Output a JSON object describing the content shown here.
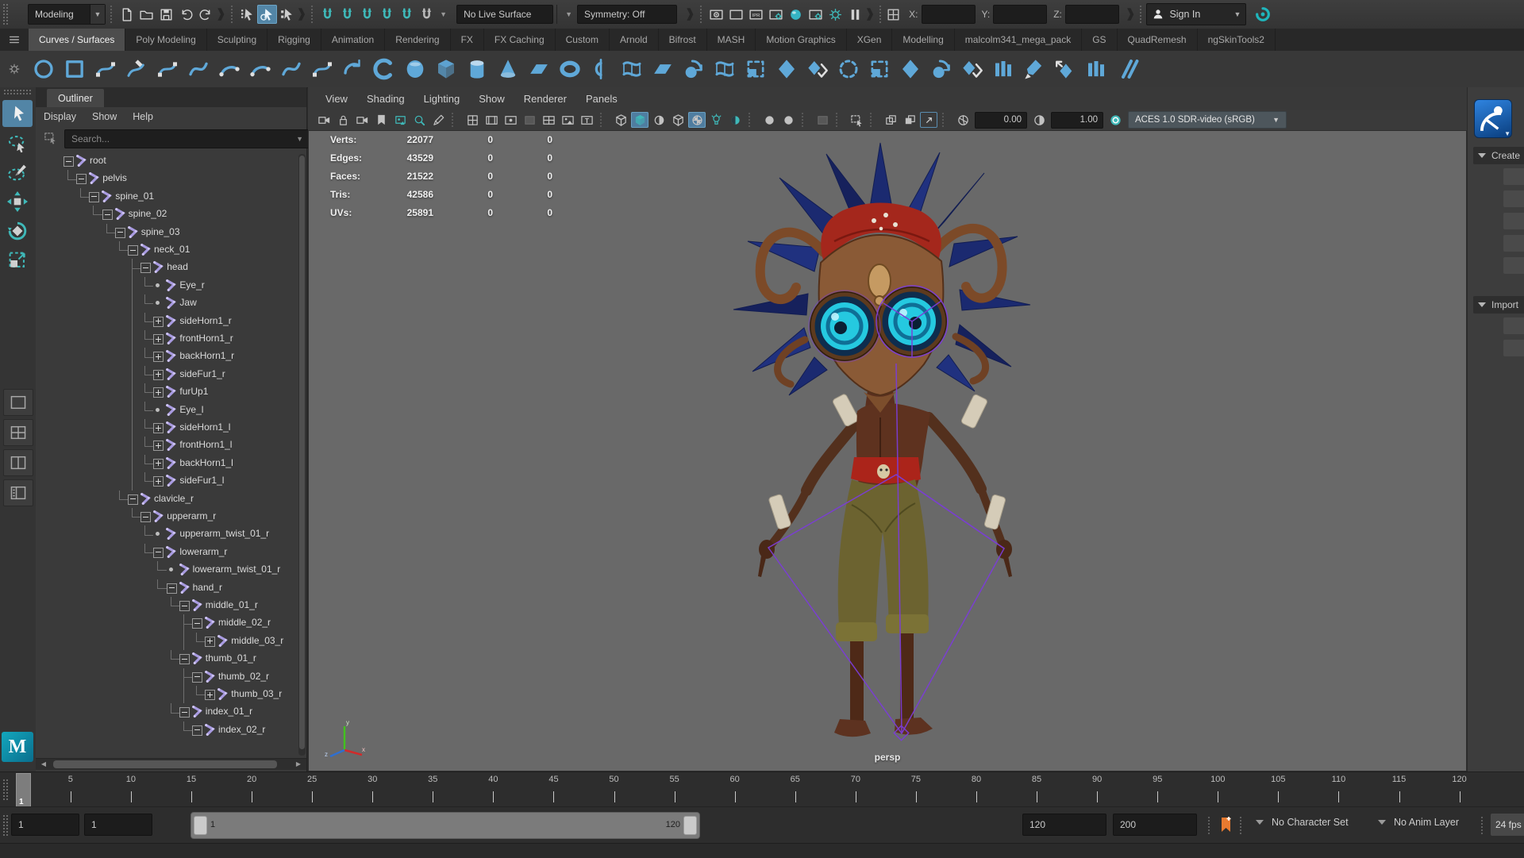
{
  "colors": {
    "accent_teal": "#3fb9b9",
    "highlight_blue": "#5285a6",
    "shelf_icon_blue": "#5fa8d8",
    "joint_purple": "#a89ae0",
    "rig_purple": "#7b3dd6",
    "viewport_bg": "#696969",
    "bookmark_orange": "#e87a30"
  },
  "top_toolbar": {
    "menu_set": "Modeling",
    "file_icons": [
      "new-scene-icon",
      "open-scene-icon",
      "save-scene-icon",
      "undo-icon",
      "redo-icon"
    ],
    "selection_icons": [
      "select-hierarchy-icon",
      "select-object-icon",
      "select-component-icon"
    ],
    "active_selection": "select-object-icon",
    "snap_icons": [
      "snap-grid-icon",
      "snap-curve-icon",
      "snap-point-icon",
      "snap-projected-center-icon",
      "snap-view-plane-icon",
      "make-live-icon"
    ],
    "live_surface": "No Live Surface",
    "symmetry": "Symmetry: Off",
    "render_icons": [
      "render-view-icon",
      "render-current-frame-icon",
      "ipr-render-icon",
      "render-settings-icon",
      "hypershade-icon",
      "light-editor-icon",
      "interactive-shading-icon",
      "pause-viewport-icon"
    ],
    "coords": {
      "x_label": "X:",
      "y_label": "Y:",
      "z_label": "Z:",
      "x_value": "",
      "y_value": "",
      "z_value": ""
    },
    "sign_in": "Sign In"
  },
  "shelf": {
    "tabs": [
      "Curves / Surfaces",
      "Poly Modeling",
      "Sculpting",
      "Rigging",
      "Animation",
      "Rendering",
      "FX",
      "FX Caching",
      "Custom",
      "Arnold",
      "Bifrost",
      "MASH",
      "Motion Graphics",
      "XGen",
      "Modelling",
      "malcolm341_mega_pack",
      "GS",
      "QuadRemesh",
      "ngSkinTools2"
    ],
    "active_tab": "Curves / Surfaces",
    "icons": [
      "nurbs-circle",
      "nurbs-square",
      "cv-curve-tool",
      "pencil-curve-tool",
      "ep-curve-tool",
      "bezier-curve-tool",
      "three-point-arc",
      "two-point-arc",
      "curve-fillet",
      "insert-knot",
      "extend-curve",
      "offset-curve",
      "nurbs-sphere",
      "nurbs-cube",
      "nurbs-cylinder",
      "nurbs-cone",
      "nurbs-plane",
      "nurbs-torus",
      "revolve",
      "loft",
      "planar",
      "extrude",
      "birail",
      "boundary",
      "bevel",
      "bevel-plus",
      "trim-tool",
      "untrim",
      "intersect-surfaces",
      "project-curve",
      "surface-fillet",
      "stitch",
      "sculpt-surfaces-tool",
      "smooth-curve",
      "rebuild-surface",
      "booleans"
    ]
  },
  "toolbox": {
    "tools": [
      "select-tool",
      "lasso-select-tool",
      "paint-select-tool",
      "move-tool",
      "rotate-tool",
      "scale-tool"
    ],
    "active_tool": "select-tool",
    "layouts": [
      "single-pane-layout",
      "four-pane-layout",
      "two-pane-layout",
      "outliner-persp-layout"
    ]
  },
  "outliner": {
    "title": "Outliner",
    "menus": [
      "Display",
      "Show",
      "Help"
    ],
    "search_placeholder": "Search...",
    "tree": [
      {
        "label": "root",
        "depth": 0,
        "exp": "minus"
      },
      {
        "label": "pelvis",
        "depth": 1,
        "exp": "minus"
      },
      {
        "label": "spine_01",
        "depth": 2,
        "exp": "minus"
      },
      {
        "label": "spine_02",
        "depth": 3,
        "exp": "minus"
      },
      {
        "label": "spine_03",
        "depth": 4,
        "exp": "minus"
      },
      {
        "label": "neck_01",
        "depth": 5,
        "exp": "minus"
      },
      {
        "label": "head",
        "depth": 6,
        "exp": "minus"
      },
      {
        "label": "Eye_r",
        "depth": 7,
        "exp": "leaf"
      },
      {
        "label": "Jaw",
        "depth": 7,
        "exp": "leaf"
      },
      {
        "label": "sideHorn1_r",
        "depth": 7,
        "exp": "plus"
      },
      {
        "label": "frontHorn1_r",
        "depth": 7,
        "exp": "plus"
      },
      {
        "label": "backHorn1_r",
        "depth": 7,
        "exp": "plus"
      },
      {
        "label": "sideFur1_r",
        "depth": 7,
        "exp": "plus"
      },
      {
        "label": "furUp1",
        "depth": 7,
        "exp": "plus"
      },
      {
        "label": "Eye_l",
        "depth": 7,
        "exp": "leaf"
      },
      {
        "label": "sideHorn1_l",
        "depth": 7,
        "exp": "plus"
      },
      {
        "label": "frontHorn1_l",
        "depth": 7,
        "exp": "plus"
      },
      {
        "label": "backHorn1_l",
        "depth": 7,
        "exp": "plus"
      },
      {
        "label": "sideFur1_l",
        "depth": 7,
        "exp": "plus"
      },
      {
        "label": "clavicle_r",
        "depth": 5,
        "exp": "minus"
      },
      {
        "label": "upperarm_r",
        "depth": 6,
        "exp": "minus"
      },
      {
        "label": "upperarm_twist_01_r",
        "depth": 7,
        "exp": "leaf"
      },
      {
        "label": "lowerarm_r",
        "depth": 7,
        "exp": "minus"
      },
      {
        "label": "lowerarm_twist_01_r",
        "depth": 8,
        "exp": "leaf"
      },
      {
        "label": "hand_r",
        "depth": 8,
        "exp": "minus"
      },
      {
        "label": "middle_01_r",
        "depth": 9,
        "exp": "minus"
      },
      {
        "label": "middle_02_r",
        "depth": 10,
        "exp": "minus"
      },
      {
        "label": "middle_03_r",
        "depth": 11,
        "exp": "plus"
      },
      {
        "label": "thumb_01_r",
        "depth": 9,
        "exp": "minus"
      },
      {
        "label": "thumb_02_r",
        "depth": 10,
        "exp": "minus"
      },
      {
        "label": "thumb_03_r",
        "depth": 11,
        "exp": "plus"
      },
      {
        "label": "index_01_r",
        "depth": 9,
        "exp": "minus"
      },
      {
        "label": "index_02_r",
        "depth": 10,
        "exp": "minus"
      }
    ]
  },
  "viewport": {
    "menus": [
      "View",
      "Shading",
      "Lighting",
      "Show",
      "Renderer",
      "Panels"
    ],
    "toolbar": [
      {
        "type": "icon",
        "name": "select-camera-icon"
      },
      {
        "type": "icon",
        "name": "lock-camera-icon"
      },
      {
        "type": "icon",
        "name": "camera-attributes-icon"
      },
      {
        "type": "icon",
        "name": "bookmark-icon"
      },
      {
        "type": "icon",
        "name": "image-plane-icon",
        "teal": true
      },
      {
        "type": "icon",
        "name": "pan-zoom-icon",
        "teal": true
      },
      {
        "type": "icon",
        "name": "grease-pencil-icon"
      },
      {
        "type": "sep"
      },
      {
        "type": "icon",
        "name": "grid-icon"
      },
      {
        "type": "icon",
        "name": "film-gate-icon"
      },
      {
        "type": "icon",
        "name": "resolution-gate-icon"
      },
      {
        "type": "icon",
        "name": "gate-mask-icon"
      },
      {
        "type": "icon",
        "name": "field-chart-icon"
      },
      {
        "type": "icon",
        "name": "safe-action-icon"
      },
      {
        "type": "icon",
        "name": "safe-title-icon"
      },
      {
        "type": "sep"
      },
      {
        "type": "icon",
        "name": "wireframe-icon"
      },
      {
        "type": "icon",
        "name": "smooth-shade-icon",
        "teal": true,
        "active": true
      },
      {
        "type": "icon",
        "name": "bounding-box-icon"
      },
      {
        "type": "icon",
        "name": "wireframe-on-shaded-icon"
      },
      {
        "type": "icon",
        "name": "textured-icon",
        "active": true
      },
      {
        "type": "icon",
        "name": "use-all-lights-icon",
        "teal": true
      },
      {
        "type": "icon",
        "name": "shadows-icon",
        "teal": true
      },
      {
        "type": "sep"
      },
      {
        "type": "icon",
        "name": "occlusion-icon"
      },
      {
        "type": "icon",
        "name": "motion-blur-icon"
      },
      {
        "type": "sep"
      },
      {
        "type": "icon",
        "name": "multisample-icon"
      },
      {
        "type": "sep"
      },
      {
        "type": "icon",
        "name": "isolate-select-icon"
      },
      {
        "type": "sep"
      },
      {
        "type": "icon",
        "name": "xray-icon"
      },
      {
        "type": "icon",
        "name": "xray-joints-icon"
      },
      {
        "type": "icon",
        "name": "fullscreen-icon"
      },
      {
        "type": "sep"
      },
      {
        "type": "icon",
        "name": "exposure-icon"
      },
      {
        "type": "field",
        "name": "exposure-field",
        "bind": "exposure"
      },
      {
        "type": "icon",
        "name": "gamma-icon"
      },
      {
        "type": "field",
        "name": "gamma-field",
        "bind": "gamma"
      },
      {
        "type": "icon",
        "name": "color-management-icon",
        "teal": true
      },
      {
        "type": "dropdown",
        "name": "color-space-dropdown",
        "bind": "color_space"
      }
    ],
    "exposure": "0.00",
    "gamma": "1.00",
    "color_space": "ACES 1.0 SDR-video (sRGB)",
    "hud": {
      "rows": [
        {
          "label": "Verts:",
          "value": "22077",
          "c2": "0",
          "c3": "0"
        },
        {
          "label": "Edges:",
          "value": "43529",
          "c2": "0",
          "c3": "0"
        },
        {
          "label": "Faces:",
          "value": "21522",
          "c2": "0",
          "c3": "0"
        },
        {
          "label": "Tris:",
          "value": "42586",
          "c2": "0",
          "c3": "0"
        },
        {
          "label": "UVs:",
          "value": "25891",
          "c2": "0",
          "c3": "0"
        }
      ]
    },
    "camera_label": "persp"
  },
  "right_panel": {
    "icon": "character-controls-icon",
    "sections": [
      {
        "label": "Create",
        "rows": 5
      },
      {
        "label": "Import",
        "rows": 2
      }
    ]
  },
  "timeline": {
    "current_frame": "1",
    "ticks": [
      "5",
      "10",
      "15",
      "20",
      "25",
      "30",
      "35",
      "40",
      "45",
      "50",
      "55",
      "60",
      "65",
      "70",
      "75",
      "80",
      "85",
      "90",
      "95",
      "100",
      "105",
      "110",
      "115",
      "120"
    ]
  },
  "range_bar": {
    "anim_start": "1",
    "playback_start": "1",
    "slider_start_label": "1",
    "slider_end_label": "120",
    "playback_end": "120",
    "anim_end": "200",
    "character_set": "No Character Set",
    "anim_layer": "No Anim Layer",
    "fps": "24 fps"
  }
}
